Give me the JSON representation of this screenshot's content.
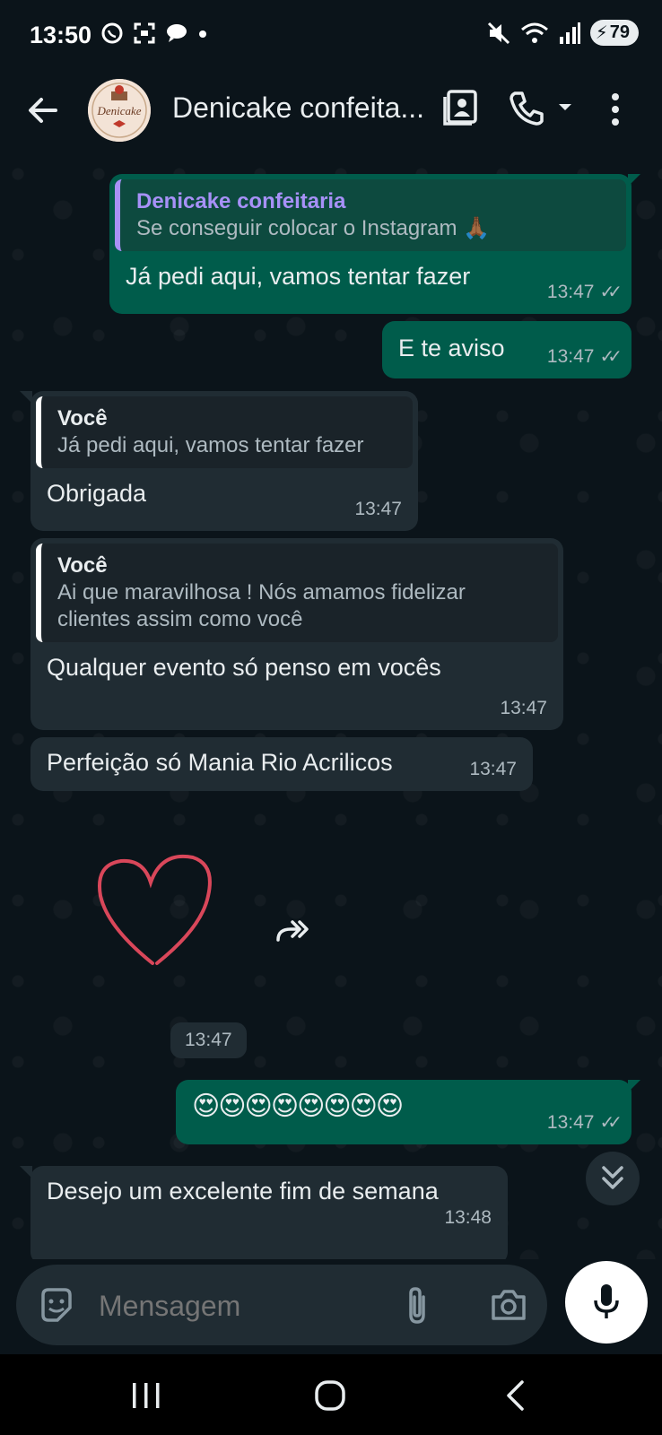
{
  "status_bar": {
    "time": "13:50",
    "battery": "79",
    "signal_sub": "5"
  },
  "header": {
    "title": "Denicake confeita...",
    "avatar_text": "Denicake"
  },
  "messages": [
    {
      "direction": "out",
      "quote_author": "Denicake confeitaria",
      "quote_text": "Se conseguir colocar o Instagram 🙏🏾",
      "text": "Já pedi aqui, vamos tentar fazer",
      "time": "13:47",
      "status": "read"
    },
    {
      "direction": "out",
      "text": "E te aviso",
      "time": "13:47",
      "status": "read"
    },
    {
      "direction": "in",
      "quote_author": "Você",
      "quote_text": "Já pedi aqui, vamos tentar fazer",
      "text": "Obrigada",
      "time": "13:47"
    },
    {
      "direction": "in",
      "quote_author": "Você",
      "quote_text_1": "Ai que maravilhosa ! Nós amamos fidelizar",
      "quote_text_2": "clientes assim como você",
      "text": "Qualquer evento só penso em vocês",
      "time": "13:47"
    },
    {
      "direction": "in",
      "text": "Perfeição só Mania Rio Acrilicos",
      "time": "13:47"
    },
    {
      "direction": "in",
      "type": "sticker",
      "sticker": "heart-outline",
      "time": "13:47"
    },
    {
      "direction": "out",
      "text": "😍😍😍😍😍😍😍😍",
      "time": "13:47",
      "status": "read"
    },
    {
      "direction": "in",
      "text": "Desejo um excelente fim de semana",
      "time": "13:48"
    }
  ],
  "composer": {
    "placeholder": "Mensagem"
  },
  "colors": {
    "background": "#0b141a",
    "outgoing_bubble": "#005c4b",
    "incoming_bubble": "#202c33",
    "quote_accent": "#a791f8"
  }
}
